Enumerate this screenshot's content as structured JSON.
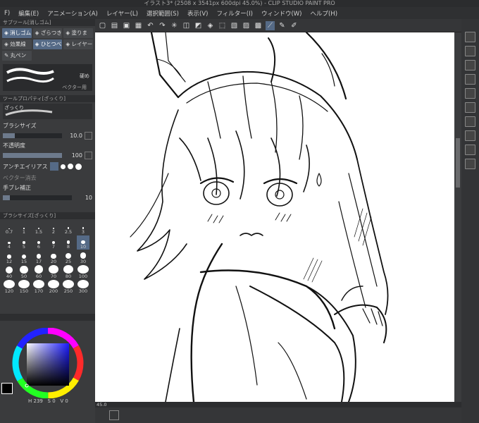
{
  "window": {
    "title": "イラスト3* (2508 x 3541px 600dpi 45.0%) - CLIP STUDIO PAINT PRO"
  },
  "menu": [
    "F)",
    "編集(E)",
    "アニメーション(A)",
    "レイヤー(L)",
    "選択範囲(S)",
    "表示(V)",
    "フィルター(I)",
    "ウィンドウ(W)",
    "ヘルプ(H)"
  ],
  "subtool": {
    "header": "サブツール[消しゴム]",
    "items": [
      "消しゴム",
      "ざらつき",
      "塗りま",
      "効果線",
      "ひとつべ",
      "レイヤー",
      "丸ペン"
    ],
    "preset_right_label": "硬め",
    "preset_bottom_label": "ベクター用"
  },
  "toolprop": {
    "header": "ツールプロパティ[ざっくり]",
    "brush_name": "ざっくり",
    "brush_size_label": "ブラシサイズ",
    "brush_size_value": "10.0",
    "opacity_label": "不透明度",
    "opacity_value": "100",
    "antialias_label": "アンチエイリアス",
    "vector_erase_label": "ベクター消去",
    "stabilize_label": "手ブレ補正",
    "stabilize_value": "10"
  },
  "brushsize": {
    "header": "ブラシサイズ[ざっくり]",
    "sizes": [
      "0.7",
      "1",
      "1.5",
      "2",
      "2.5",
      "3",
      "4",
      "5",
      "6",
      "7",
      "8",
      "10",
      "12",
      "15",
      "17",
      "20",
      "25",
      "30",
      "40",
      "50",
      "60",
      "70",
      "80",
      "100",
      "120",
      "150",
      "170",
      "200",
      "250",
      "300"
    ],
    "selected": "10"
  },
  "color": {
    "h_value": "239",
    "s_value": "0",
    "v_value": "0",
    "main": "#000000",
    "sub": "#ffffff"
  },
  "status": {
    "zoom": "45.0"
  }
}
